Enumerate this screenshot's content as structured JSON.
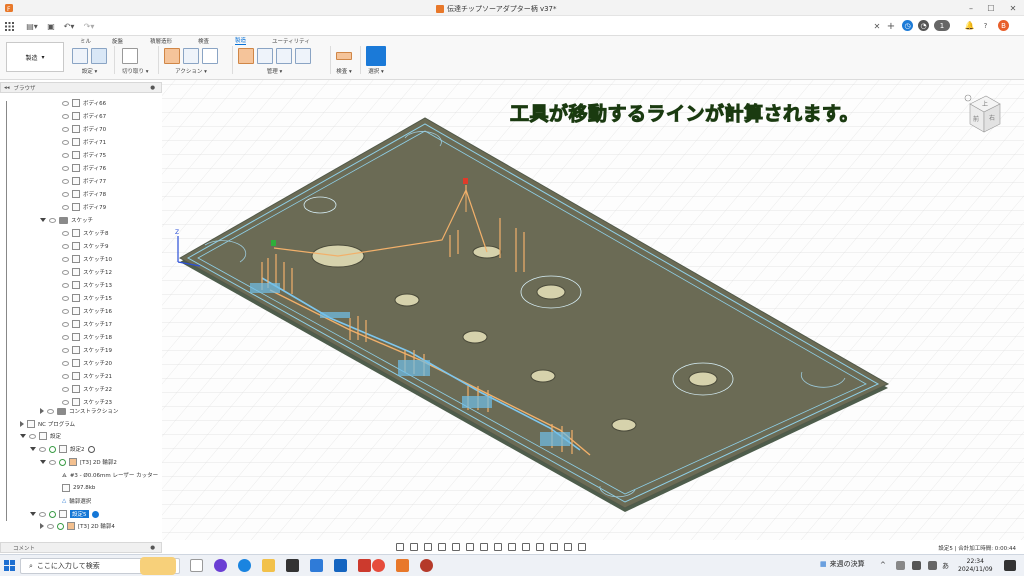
{
  "window": {
    "title": "伝達チップソーアダプター柄 v37*",
    "notification_count": "1"
  },
  "ribbon": {
    "workspace": "製造",
    "tabs": [
      "ミル",
      "旋盤",
      "積層造形",
      "検査",
      "製造",
      "ユーティリティ"
    ],
    "active_tab": "製造",
    "groups": [
      "設定",
      "切り取り",
      "アクション",
      "管理",
      "検査",
      "選択"
    ]
  },
  "browser": {
    "title": "ブラウザ",
    "bodies": [
      "ボディ66",
      "ボディ67",
      "ボディ70",
      "ボディ71",
      "ボディ75",
      "ボディ76",
      "ボディ77",
      "ボディ78",
      "ボディ79"
    ],
    "sketch_folder": "スケッチ",
    "sketches": [
      "スケッチ8",
      "スケッチ9",
      "スケッチ10",
      "スケッチ12",
      "スケッチ13",
      "スケッチ15",
      "スケッチ16",
      "スケッチ17",
      "スケッチ18",
      "スケッチ19",
      "スケッチ20",
      "スケッチ21",
      "スケッチ22",
      "スケッチ23"
    ],
    "construction": "コンストラクション",
    "nc_program": "NC プログラム",
    "setups": "設定",
    "setup2": "設定2",
    "op_2d_contour2": "[T3] 2D 輪郭2",
    "tool": "#3 - Ø0.06mm レーザー カッター",
    "size": "297.8kb",
    "contour_select": "輪郭選択",
    "setup5": "設定5",
    "op_2d_contour4": "[T3] 2D 輪郭4"
  },
  "viewport": {
    "caption": "工具が移動するラインが計算されます。",
    "viewcube": {
      "top": "上",
      "front": "前",
      "right": "右"
    },
    "axis_z": "Z"
  },
  "bottom": {
    "comment": "コメント",
    "status": "設定5 | 合計加工時間: 0:00:44"
  },
  "taskbar": {
    "search_placeholder": "ここに入力して検索",
    "weather": "来週の決算",
    "time": "22:34",
    "date": "2024/11/09"
  }
}
